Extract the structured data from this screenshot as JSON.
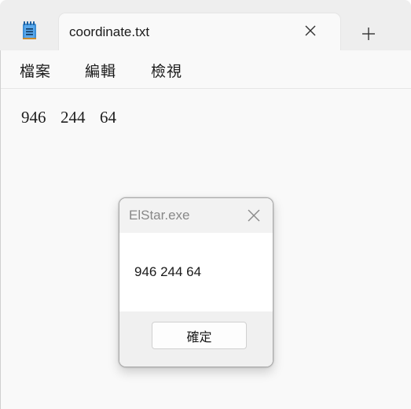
{
  "window": {
    "tab_title": "coordinate.txt",
    "app_icon": "notepad-icon",
    "close_tab_icon": "close-icon",
    "new_tab_icon": "plus-icon"
  },
  "menu": {
    "items": [
      "檔案",
      "編輯",
      "檢視"
    ]
  },
  "editor": {
    "content": "946  244  64"
  },
  "dialog": {
    "title": "ElStar.exe",
    "message": "946 244 64",
    "ok_label": "確定",
    "close_icon": "close-icon"
  },
  "colors": {
    "accent": "#0f6cbd",
    "icon_blue": "#3d8fd6"
  }
}
